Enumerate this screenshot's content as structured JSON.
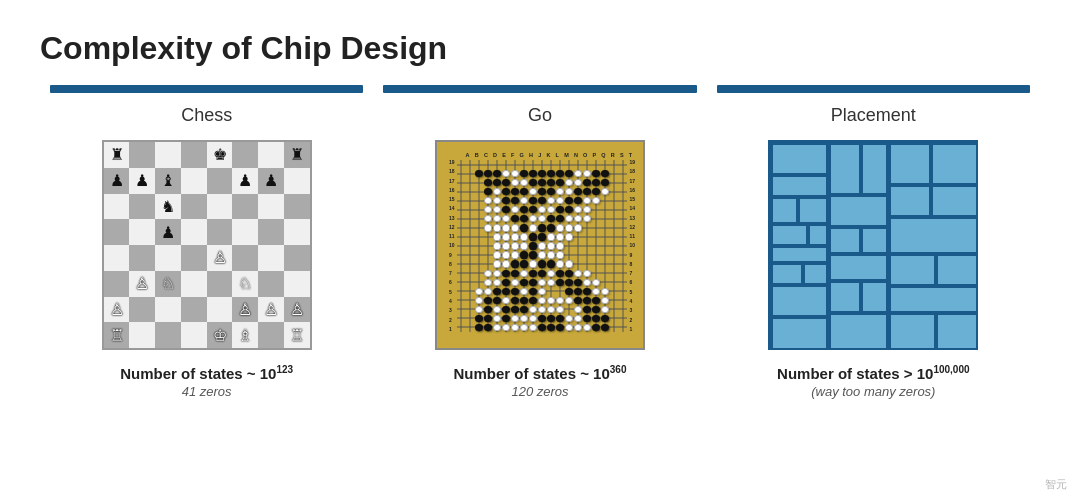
{
  "title": "Complexity of Chip Design",
  "columns": [
    {
      "id": "chess",
      "label": "Chess",
      "stat_main": "Number of states ~ 10",
      "stat_exp": "123",
      "stat_sub": "41 zeros"
    },
    {
      "id": "go",
      "label": "Go",
      "stat_main": "Number of states ~ 10",
      "stat_exp": "360",
      "stat_sub": "120 zeros"
    },
    {
      "id": "placement",
      "label": "Placement",
      "stat_main": "Number of states > 10",
      "stat_exp": "100,000",
      "stat_sub": "(way too many zeros)"
    }
  ]
}
